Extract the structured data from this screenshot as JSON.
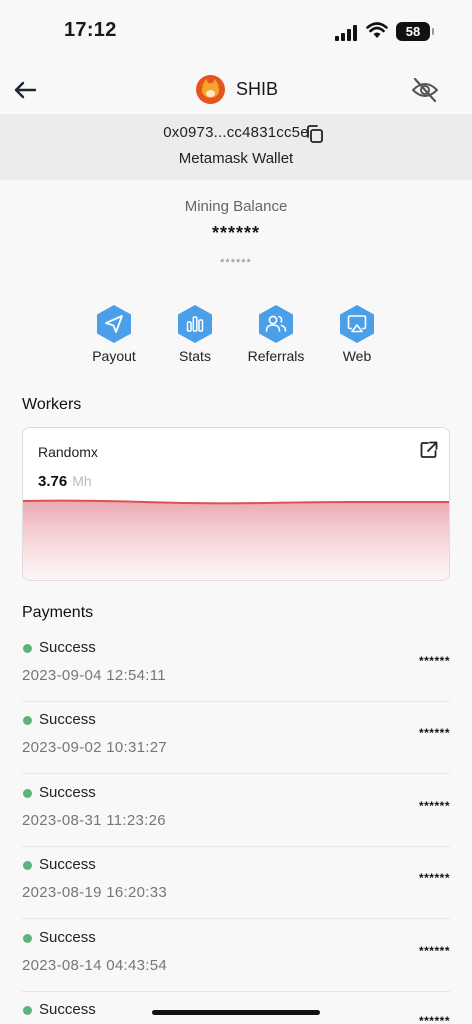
{
  "status_bar": {
    "time": "17:12",
    "battery": "58"
  },
  "header": {
    "title": "SHIB"
  },
  "wallet": {
    "address": "0x0973...cc4831cc5e",
    "name": "Metamask Wallet"
  },
  "balance": {
    "label": "Mining Balance",
    "value": "******",
    "sub_value": "******"
  },
  "actions": [
    {
      "label": "Payout",
      "icon": "send-icon"
    },
    {
      "label": "Stats",
      "icon": "bar-chart-icon"
    },
    {
      "label": "Referrals",
      "icon": "users-icon"
    },
    {
      "label": "Web",
      "icon": "airplay-icon"
    }
  ],
  "workers": {
    "title": "Workers",
    "items": [
      {
        "name": "Randomx",
        "hashrate": "3.76",
        "unit": "Mh"
      }
    ]
  },
  "payments": {
    "title": "Payments",
    "items": [
      {
        "status": "Success",
        "date": "2023-09-04 12:54:11",
        "amount": "******"
      },
      {
        "status": "Success",
        "date": "2023-09-02 10:31:27",
        "amount": "******"
      },
      {
        "status": "Success",
        "date": "2023-08-31 11:23:26",
        "amount": "******"
      },
      {
        "status": "Success",
        "date": "2023-08-19 16:20:33",
        "amount": "******"
      },
      {
        "status": "Success",
        "date": "2023-08-14 04:43:54",
        "amount": "******"
      },
      {
        "status": "Success",
        "date": "",
        "amount": "******"
      }
    ]
  },
  "colors": {
    "accent": "#4a9fe8",
    "success": "#5db47a",
    "chart_line": "#d9534f"
  }
}
